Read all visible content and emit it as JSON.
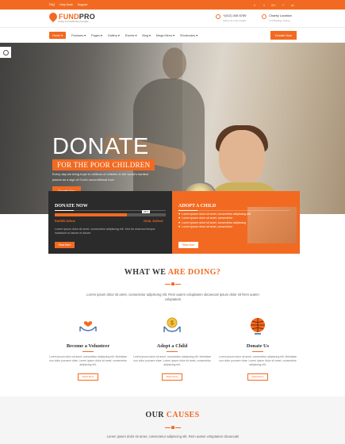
{
  "topbar": {
    "links": [
      "FAQ",
      "Help Desk",
      "Support"
    ],
    "social": [
      "f",
      "t",
      "G+",
      "♡",
      "in"
    ]
  },
  "header": {
    "logo_main": "FUND",
    "logo_accent": "PRO",
    "logo_sub": "Charity & Crowdfunding Template",
    "phone": "+(012) 345 6789",
    "phone_sub": "Call us for more details!",
    "location": "Charity Location",
    "location_sub": "XYZ Building, Sydney"
  },
  "nav": {
    "items": [
      "Home ▾",
      "Features ▾",
      "Pages ▾",
      "Gallery ▾",
      "Events ▾",
      "Blog ▾",
      "Mega Menu ▾",
      "Shortcodes ▾"
    ],
    "cta": "Donate Now"
  },
  "hero": {
    "title": "DONATE",
    "subtitle": "FOR THE POOR CHILDREN",
    "text": "Every day we bring hope to millions of children in the world's hardest places as a sign of God's unconditional love.",
    "button": "Donate Now"
  },
  "donate_panel": {
    "title": "DONATE NOW",
    "progress_pct": 65,
    "progress_label": "65%",
    "raised": "RAISED $49cm",
    "goal": "GOAL $120m0",
    "text": "Lorem ipsum dolor sit amet, consectetur adipiscing elit. Sed do eiusmod tempor incididunt ut labore et dolore.",
    "button": "Read More"
  },
  "adopt_panel": {
    "title": "ADOPT A CHILD",
    "rows": [
      "Lorem ipsum dolor sit amet, consectetur adipiscing elit",
      "Lorem ipsum dolor sit amet, consectetur",
      "Lorem ipsum dolor sit amet, consectetur adipiscing",
      "Lorem ipsum dolor sit amet, consectetur"
    ],
    "button": "Read More"
  },
  "what_we_do": {
    "title_main": "WHAT WE ",
    "title_accent": "ARE DOING?",
    "text": "Lorem ipsum dolor sit amet, consectetur adipiscing elit. Rem autem voluptatem obcaecati! ipsum dolor sit Rem autem voluptatem",
    "features": [
      {
        "title": "Become a Volunteer",
        "text": "Lorem ipsum dolor sit amet, consectetur adipiscing elit. Molestiae non dolor posuere vitae. Lorem ipsum dolor sit amet, consectetur adipiscing elit.",
        "button": "Read More",
        "icon": "hands-heart-icon"
      },
      {
        "title": "Adopt a Child",
        "text": "Lorem ipsum dolor sit amet, consectetur adipiscing elit. Molestiae non dolor posuere vitae. Lorem ipsum dolor sit amet, consectetur adipiscing elit.",
        "button": "Read More",
        "icon": "coin-hands-icon"
      },
      {
        "title": "Donate Us",
        "text": "Lorem ipsum dolor sit amet, consectetur adipiscing elit. Molestiae non dolor posuere vitae. Lorem ipsum dolor sit amet, consectetur adipiscing elit.",
        "button": "Read More",
        "icon": "globe-icon"
      }
    ]
  },
  "causes": {
    "title_main": "OUR ",
    "title_accent": "CAUSES",
    "text": "Lorem ipsum dolor sit amet, consectetur adipiscing elit. Rem autem voluptatem obcaecati!"
  },
  "colors": {
    "accent": "#f26a21",
    "dark": "#2b2b2b"
  }
}
